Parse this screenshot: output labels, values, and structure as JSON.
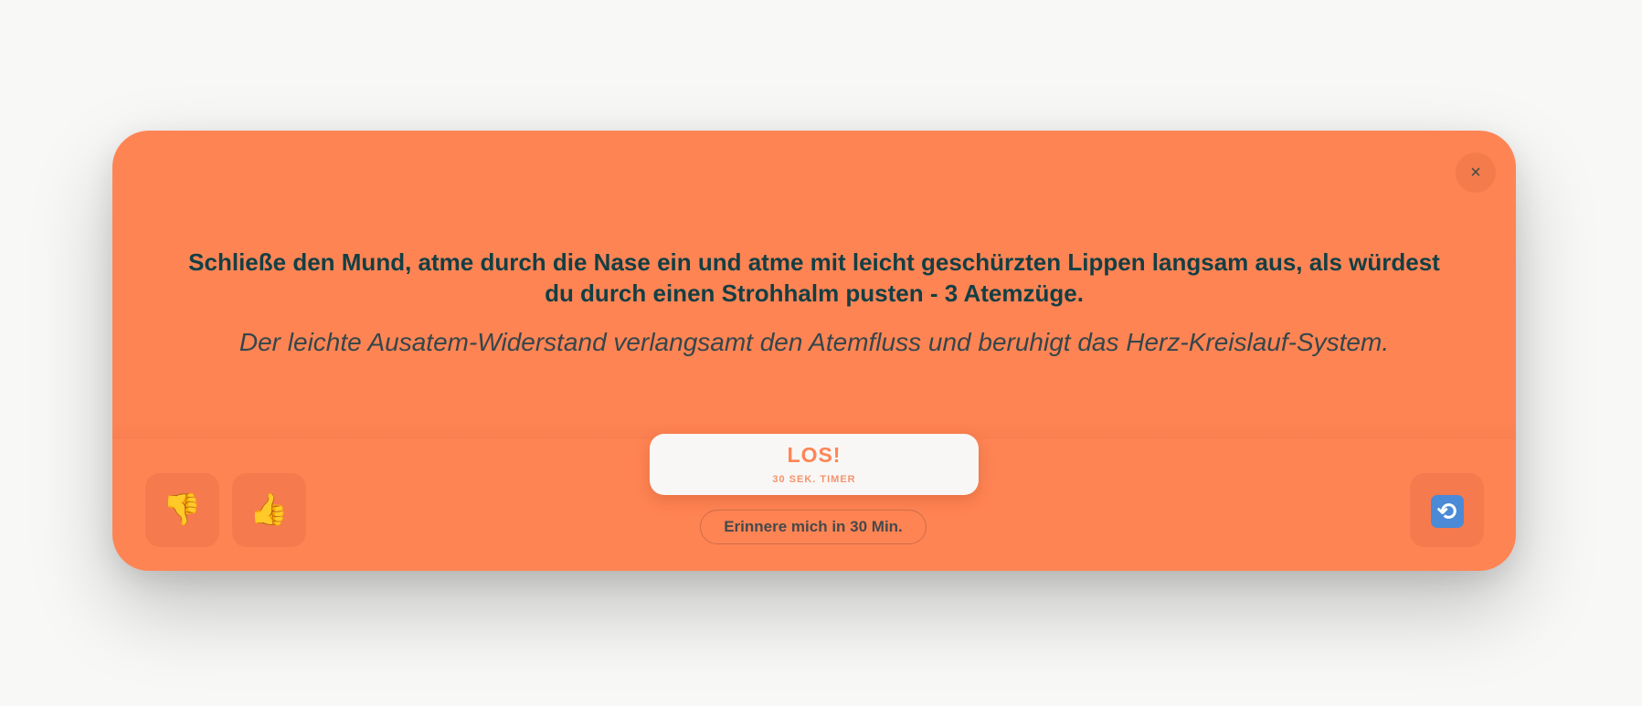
{
  "dialog": {
    "close_icon": "×",
    "instruction": "Schließe den Mund, atme durch die Nase ein und atme mit leicht geschürzten Lippen langsam aus, als würdest du durch einen Strohhalm pusten - 3 Atemzüge.",
    "explanation": "Der leichte Ausatem-Widerstand verlangsamt den Atemfluss und beruhigt das Herz-Kreislauf-System.",
    "start_button": {
      "label": "LOS!",
      "sublabel": "30 SEK. TIMER"
    },
    "remind_button": "Erinnere mich in 30 Min.",
    "feedback": {
      "dislike_icon": "👎",
      "like_icon": "👍"
    },
    "repeat_icon": "🔁"
  },
  "colors": {
    "background": "#f8f8f7",
    "card": "#ff8454",
    "text_dark": "#123f44",
    "button_light": "#f8f7f5"
  }
}
